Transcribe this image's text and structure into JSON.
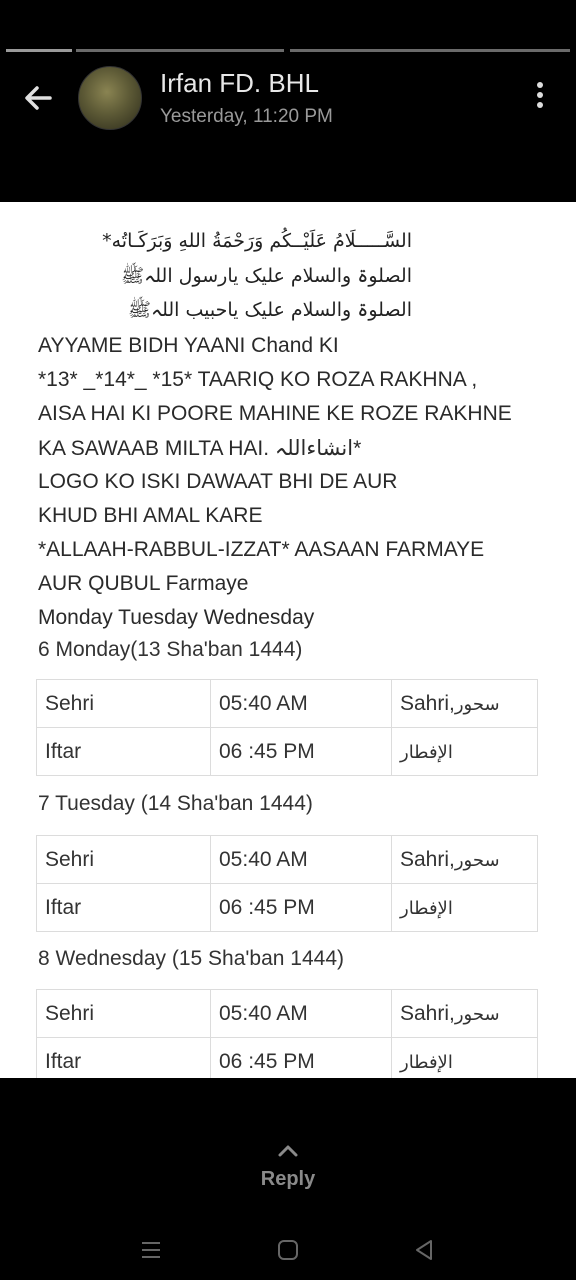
{
  "header": {
    "name": "Irfan FD. BHL",
    "time": "Yesterday, 11:20 PM"
  },
  "message": {
    "arabic_lines": [
      "السَّـــــلَامُ عَلَيْــكُم وَرَحْمَةُ اللهِ وَبَرَكَـاتُه*",
      "الصلوۃ والسلام علیک یارسول اللہﷺ",
      "الصلوۃ والسلام علیک یاحبیب اللہﷺ"
    ],
    "lines": [
      " AYYAME BIDH YAANI Chand KI",
      "*13* _*14*_ *15* TAARIQ KO ROZA RAKHNA ,",
      "AISA HAI KI POORE MAHINE KE ROZE RAKHNE",
      "KA SAWAAB MILTA HAI. انشاءاللہ*",
      "LOGO KO ISKI DAWAAT BHI DE AUR",
      "KHUD BHI AMAL KARE",
      "*ALLAAH-RABBUL-IZZAT* AASAAN FARMAYE",
      "AUR QUBUL Farmaye",
      "Monday Tuesday  Wednesday"
    ],
    "days": [
      {
        "heading": "6 Monday(13 Sha'ban 1444)",
        "rows": [
          {
            "label": "Sehri",
            "time": "05:40 AM",
            "latin": "Sahri,",
            "arabic": "سحور"
          },
          {
            "label": "Iftar",
            "time": "06 :45 PM",
            "latin": "",
            "arabic": "الإفطار"
          }
        ]
      },
      {
        "heading": "7 Tuesday (14 Sha'ban 1444)",
        "rows": [
          {
            "label": "Sehri",
            "time": "05:40 AM",
            "latin": "Sahri,",
            "arabic": "سحور"
          },
          {
            "label": "Iftar",
            "time": "06 :45 PM",
            "latin": "",
            "arabic": "الإفطار"
          }
        ]
      },
      {
        "heading": "8 Wednesday (15 Sha'ban 1444)",
        "rows": [
          {
            "label": "Sehri",
            "time": "05:40 AM",
            "latin": "Sahri,",
            "arabic": "سحور"
          },
          {
            "label": "Iftar",
            "time": "06 :45 PM",
            "latin": "",
            "arabic": "الإفطار"
          }
        ]
      }
    ]
  },
  "footer": {
    "reply_label": "Reply"
  },
  "icons": {
    "back": "arrow-left-icon",
    "more": "more-vertical-icon",
    "reply": "chevron-up-icon",
    "nav": [
      "recents-icon",
      "home-icon",
      "back-triangle-icon"
    ]
  },
  "colors": {
    "background": "#000000",
    "content_bg": "#ffffff",
    "name": "#e8e8e8",
    "time": "#9a9a9a"
  }
}
